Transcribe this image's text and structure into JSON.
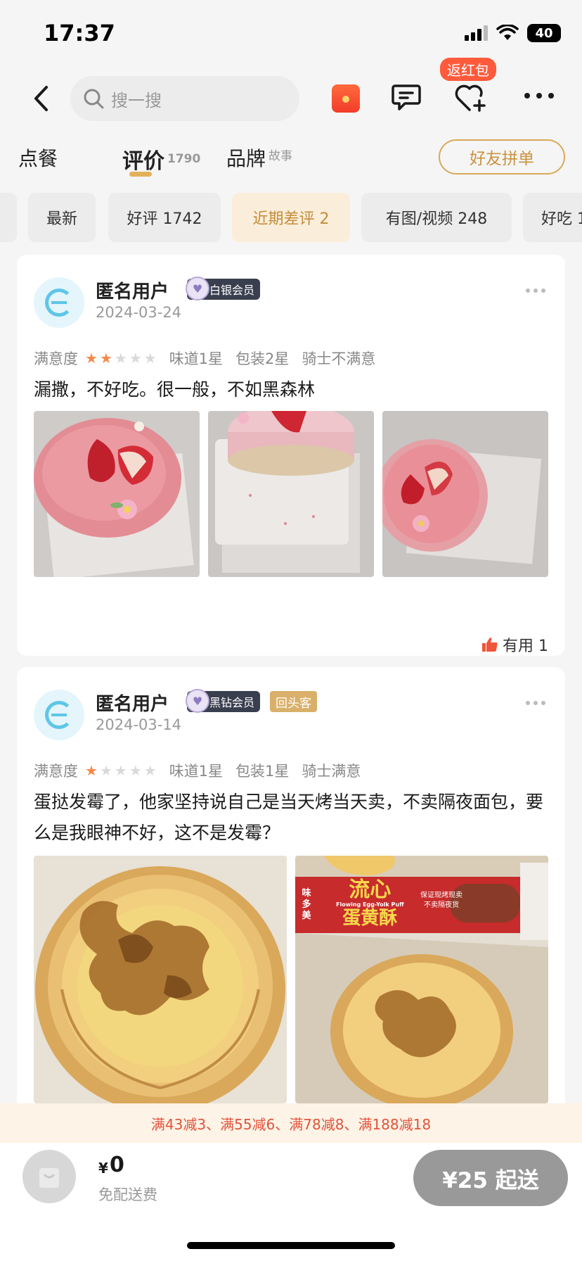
{
  "status_bar": {
    "time": "17:37",
    "battery": "40"
  },
  "nav": {
    "search_placeholder": "搜一搜",
    "return_badge": "返红包"
  },
  "tabs": [
    {
      "label": "点餐",
      "sup": ""
    },
    {
      "label": "评价",
      "sup": "1790"
    },
    {
      "label": "品牌",
      "sup": "故事"
    }
  ],
  "friend_button": "好友拼单",
  "filters": [
    {
      "label": "最新"
    },
    {
      "label": "好评 1742"
    },
    {
      "label": "近期差评 2",
      "active": true
    },
    {
      "label": "有图/视频 248"
    },
    {
      "label": "好吃 1"
    }
  ],
  "reviews": [
    {
      "user": "匿名用户",
      "member": "白银会员",
      "date": "2024-03-24",
      "satisfaction_label": "满意度",
      "stars": 2,
      "taste": "味道1星",
      "packaging": "包装2星",
      "rider": "骑士不满意",
      "text": "漏撒，不好吃。很一般，不如黑森林",
      "useful": "有用 1"
    },
    {
      "user": "匿名用户",
      "member": "黑钻会员",
      "repeat": "回头客",
      "date": "2024-03-14",
      "satisfaction_label": "满意度",
      "stars": 1,
      "taste": "味道1星",
      "packaging": "包装1星",
      "rider": "骑士满意",
      "text": "蛋挞发霉了，他家坚持说自己是当天烤当天卖，不卖隔夜面包，要么是我眼神不好，这不是发霉？",
      "box_brand": "味多美",
      "box_title_1": "流心",
      "box_title_2": "蛋黄酥",
      "box_english": "Flowing Egg-Yolk Puff",
      "box_slogan_1": "保证现烤现卖",
      "box_slogan_2": "不卖隔夜货"
    }
  ],
  "promo": "满43减3、满55减6、满78减8、满188减18",
  "bottom": {
    "currency": "¥",
    "price": "0",
    "delivery": "免配送费",
    "min_order": "¥25 起送"
  }
}
